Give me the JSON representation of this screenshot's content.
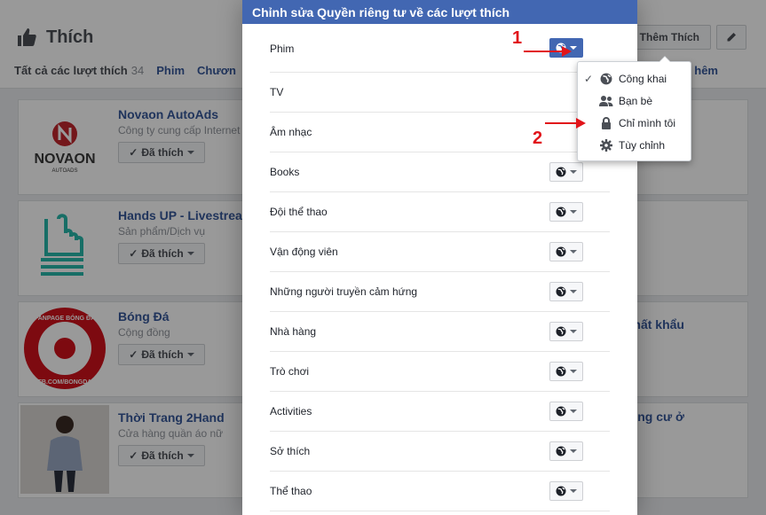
{
  "background": {
    "title": "Thích",
    "tabs": [
      {
        "label": "Tất cả các lượt thích",
        "count": "34"
      },
      {
        "label": "Phim"
      },
      {
        "label": "Chươn"
      }
    ],
    "add_like_button": "Thêm Thích",
    "right_tab": "hêm",
    "pages": [
      {
        "name": "Novaon AutoAds",
        "category": "Công ty cung cấp Internet",
        "liked": "Đã thích",
        "logo_text": "NOVAON",
        "logo_sub": "AUTOADS"
      },
      {
        "name": "Hands UP - Livestrea",
        "category": "Sản phẩm/Dịch vụ",
        "liked": "Đã thích"
      },
      {
        "name": "Bóng Đá",
        "category": "Cộng đồng",
        "liked": "Đã thích",
        "logo_top": "FANPAGE BÓNG ĐÁ",
        "logo_bottom": "FB.COM/BONGDA"
      },
      {
        "name": "Thời Trang 2Hand",
        "category": "Cửa hàng quần áo nữ",
        "liked": "Đã thích"
      }
    ],
    "right_texts": [
      "hất khẩu",
      "oặc chung cư ở"
    ]
  },
  "modal": {
    "title": "Chỉnh sửa Quyền riêng tư về các lượt thích",
    "rows": [
      {
        "label": "Phim"
      },
      {
        "label": "TV"
      },
      {
        "label": "Âm nhạc"
      },
      {
        "label": "Books"
      },
      {
        "label": "Đội thể thao"
      },
      {
        "label": "Vận động viên"
      },
      {
        "label": "Những người truyền cảm hứng"
      },
      {
        "label": "Nhà hàng"
      },
      {
        "label": "Trò chơi"
      },
      {
        "label": "Activities"
      },
      {
        "label": "Sở thích"
      },
      {
        "label": "Thể thao"
      }
    ]
  },
  "dropdown": {
    "items": [
      {
        "label": "Công khai",
        "icon": "globe-icon",
        "selected": true
      },
      {
        "label": "Bạn bè",
        "icon": "friends-icon",
        "selected": false
      },
      {
        "label": "Chỉ mình tôi",
        "icon": "lock-icon",
        "selected": false
      },
      {
        "label": "Tùy chỉnh",
        "icon": "gear-icon",
        "selected": false
      }
    ]
  },
  "annotations": {
    "step1": "1",
    "step2": "2"
  },
  "colors": {
    "header_blue": "#4267b2",
    "link_blue": "#365899",
    "annotation_red": "#e1141a"
  }
}
